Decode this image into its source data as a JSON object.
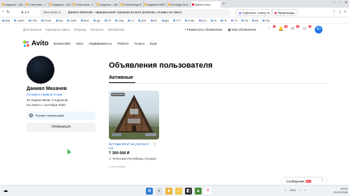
{
  "browser": {
    "tabs": [
      {
        "label": "Задания - обл"
      },
      {
        "label": "Участники - т"
      },
      {
        "label": "Задания - обл"
      },
      {
        "label": "Участники - т"
      },
      {
        "label": "Задания - обл"
      },
      {
        "label": "Fotostrategy.R"
      },
      {
        "label": "Задания №20"
      },
      {
        "label": "Коттедж 56 м"
      },
      {
        "label": "Даниял Мах"
      }
    ],
    "new_tab": "+",
    "rating": "4.3",
    "domain": "www.avito.ru",
    "page_title": "Даниял Махачев - официальная страница во всех регионах, отзывы на Авито",
    "alice_button": "Спросить Алису AI",
    "promo_button": "Промокоды",
    "bookmarks": [
      "ЮМ",
      "СБЕР",
      "ГПБ",
      "РСХБ",
      "ГАЗ",
      "СМП",
      "ФНС",
      "ДО",
      "ПТ",
      "ОЗК",
      "ГУ",
      "АТБ",
      "ЮТ",
      "ДМ",
      "ТТТ",
      "УНЮ",
      "КТЗ",
      "ГК",
      "ГЕ",
      "ТУ",
      "ЛЗ",
      "КВ",
      "РЖ"
    ]
  },
  "avito_top": {
    "links": [
      "Для бизнеса",
      "Карьера в Авито",
      "Помощь",
      "Каталоги",
      "#яПомогаю"
    ],
    "post_ad": "Разместить объявление",
    "my_ads": "Мои объявления",
    "badges": [
      "4",
      "16",
      "15",
      "4"
    ],
    "user_initial": "Ю"
  },
  "logo": {
    "text": "Avito",
    "colors": [
      "#97cf26",
      "#a169f7",
      "#0af",
      "#ff6163"
    ]
  },
  "nav": [
    "Бизнес360",
    "Авто",
    "Недвижимость",
    "Работа",
    "Услуги",
    "Ещё"
  ],
  "profile": {
    "name": "Даниял Махачев",
    "leave_review": "Оставить первый отзыв",
    "subs": "46 подписчиков, 0 подписок",
    "since": "На Авито с сентября 2020",
    "phone_verified": "Телефон подтверждён",
    "subscribe_button": "Отписаться"
  },
  "listings": {
    "heading": "Объявления пользователя",
    "tab_active": "Активные",
    "tab_count": "1",
    "items": [
      {
        "promo_label": "Промоушен",
        "title": "Коттедж 56 м² на участке 2 сот.",
        "price": "7 300 000 ₽",
        "location": "Чеченская Республика, Грозный",
        "time": "4 часа назад"
      }
    ]
  },
  "messages": {
    "label": "Сообщения",
    "count": "99+"
  },
  "taskbar": {
    "tray": [
      "ENG"
    ],
    "time": "23:07",
    "date": "03.03.2026"
  }
}
